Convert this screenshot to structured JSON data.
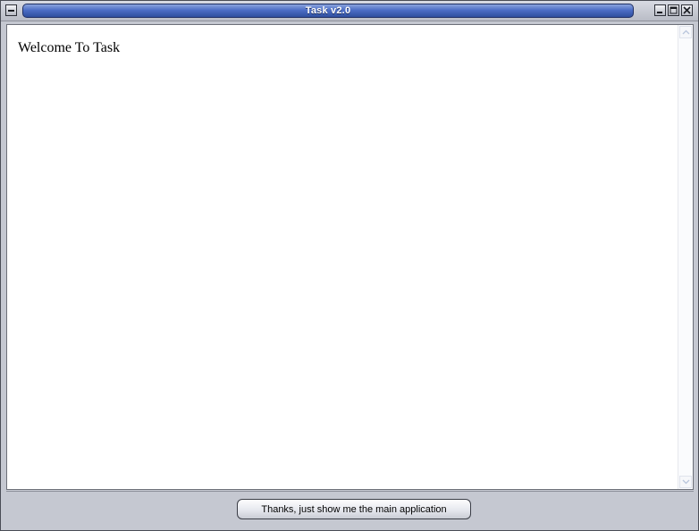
{
  "window": {
    "title": "Task v2.0",
    "colors": {
      "title_accent": "#3d5eb4",
      "frame": "#c5c8d1"
    },
    "icons": {
      "system_menu": "window-menu-icon",
      "minimize": "minimize-icon",
      "maximize": "maximize-icon",
      "close": "close-icon"
    }
  },
  "content": {
    "welcome_text": "Welcome To Task"
  },
  "footer": {
    "continue_label": "Thanks, just show me the main application"
  }
}
